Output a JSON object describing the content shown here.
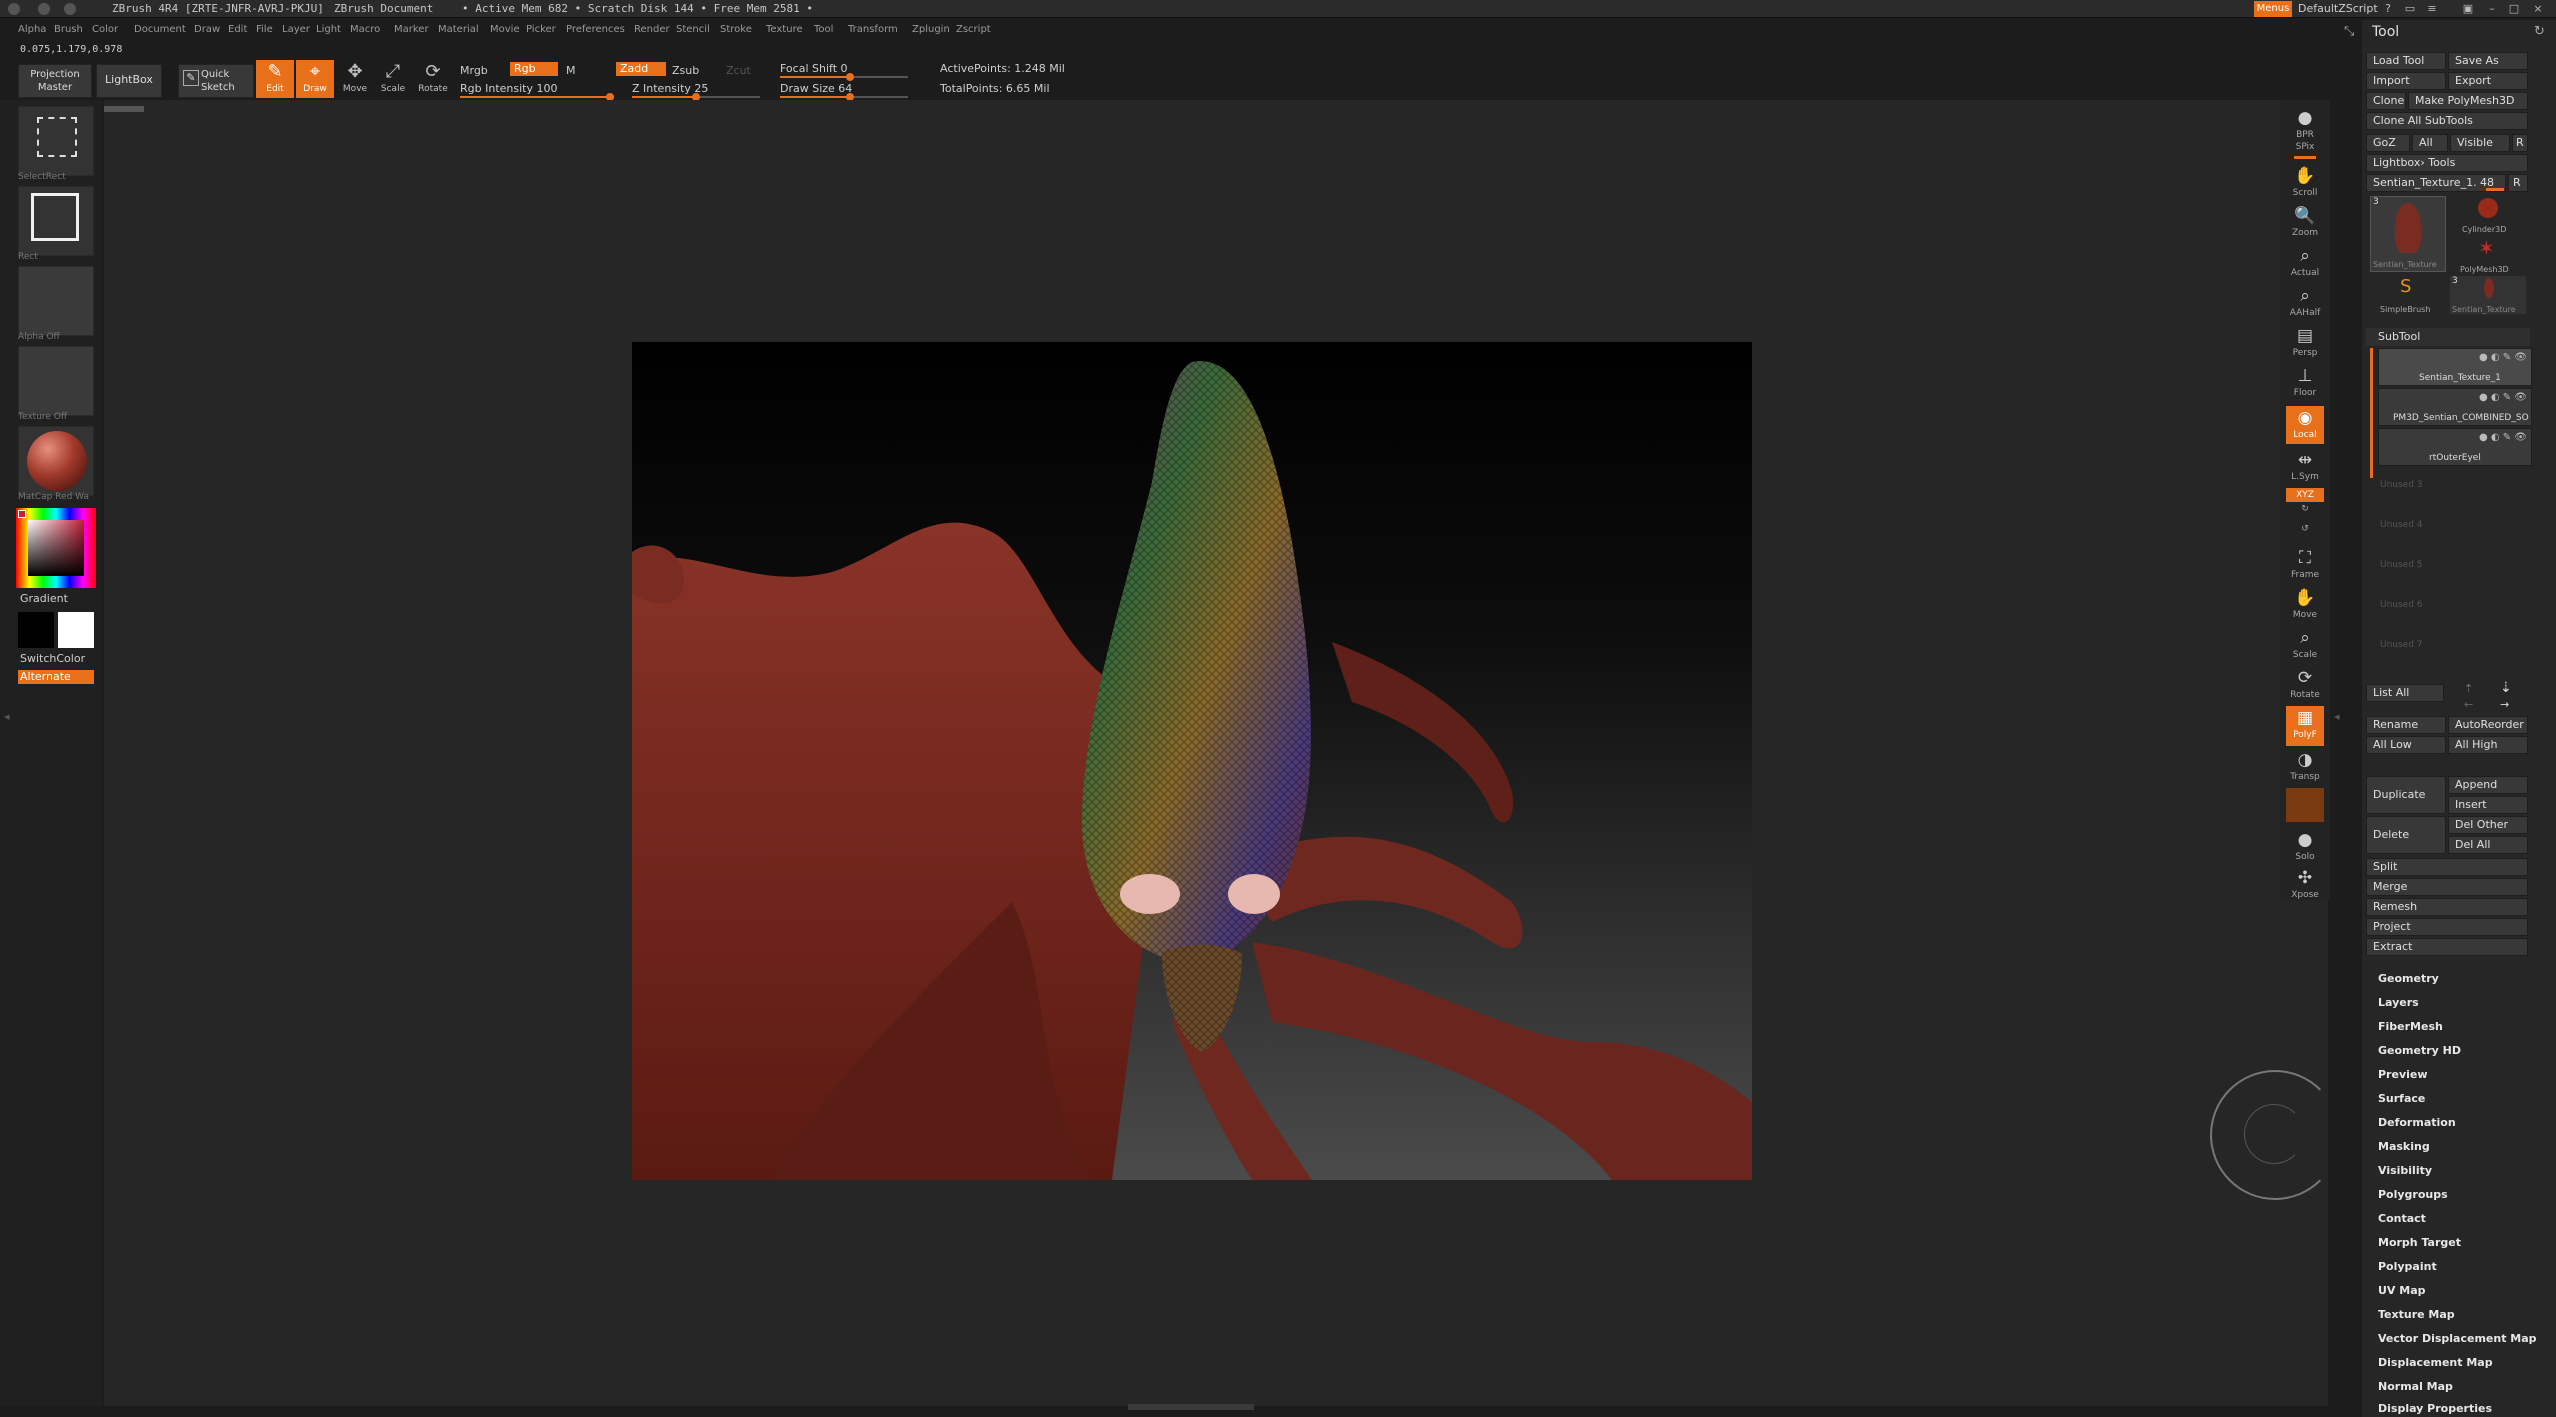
{
  "window": {
    "title_app": "ZBrush 4R4 [ZRTE-JNFR-AVRJ-PKJU]",
    "title_doc": "ZBrush Document",
    "title_mem": "•  Active Mem 682 • Scratch Disk 144 • Free Mem 2581 •",
    "menus_btn": "Menus",
    "script": "DefaultZScript"
  },
  "menubar": [
    "Alpha",
    "Brush",
    "Color",
    "Document",
    "Draw",
    "Edit",
    "File",
    "Layer",
    "Light",
    "Macro",
    "Marker",
    "Material",
    "Movie",
    "Picker",
    "Preferences",
    "Render",
    "Stencil",
    "Stroke",
    "Texture",
    "Tool",
    "Transform",
    "Zplugin",
    "Zscript"
  ],
  "coords": "0.075,1.179,0.978",
  "toolbar": {
    "projection_master": "Projection\nMaster",
    "lightbox": "LightBox",
    "quick_sketch": "Quick\nSketch",
    "edit": "Edit",
    "draw": "Draw",
    "move": "Move",
    "scale": "Scale",
    "rotate": "Rotate",
    "mrgb": "Mrgb",
    "rgb": "Rgb",
    "m": "M",
    "rgb_intensity": "Rgb Intensity 100",
    "zadd": "Zadd",
    "zsub": "Zsub",
    "zcut": "Zcut",
    "z_intensity": "Z Intensity 25",
    "focal_shift": "Focal Shift 0",
    "draw_size": "Draw Size 64",
    "active_points": "ActivePoints: 1.248  Mil",
    "total_points": "TotalPoints: 6.65  Mil",
    "rgb_intensity_value": 100,
    "z_intensity_value": 25,
    "focal_shift_value": 0,
    "draw_size_value": 64
  },
  "left_shelf": {
    "select_rect": "SelectRect",
    "rect": "Rect",
    "alpha_off": "Alpha Off",
    "texture_off": "Texture Off",
    "matcap": "MatCap Red Wa",
    "gradient": "Gradient",
    "switch_color": "SwitchColor",
    "alternate": "Alternate"
  },
  "right_shelf": [
    "BPR",
    "SPix",
    "Scroll",
    "Zoom",
    "Actual",
    "AAHalf",
    "Persp",
    "Floor",
    "Local",
    "L.Sym",
    "XYZ",
    "",
    "",
    "Frame",
    "Move",
    "Scale",
    "Rotate",
    "PolyF",
    "Transp",
    "",
    "Solo",
    "Xpose"
  ],
  "tool_panel": {
    "title": "Tool",
    "load_tool": "Load Tool",
    "save_as": "Save As",
    "import": "Import",
    "export": "Export",
    "clone": "Clone",
    "make_polymesh": "Make PolyMesh3D",
    "clone_all": "Clone  All SubTools",
    "goz": "GoZ",
    "all": "All",
    "visible": "Visible",
    "r": "R",
    "lightbox_tools": "Lightbox› Tools",
    "current_tool": "Sentian_Texture_1. 48",
    "thumbs": [
      {
        "name": "Sentian_Texture",
        "count": "3"
      },
      {
        "name": "Cylinder3D",
        "count": ""
      },
      {
        "name": "PolyMesh3D",
        "count": ""
      },
      {
        "name": "SimpleBrush",
        "count": ""
      },
      {
        "name": "Sentian_Texture",
        "count": "3"
      }
    ],
    "subtool_header": "SubTool",
    "subtools": [
      "Sentian_Texture_1",
      "PM3D_Sentian_COMBINED_SO",
      "rtOuterEyel"
    ],
    "empty_slots": [
      "Unused 3",
      "Unused 4",
      "Unused 5",
      "Unused 6",
      "Unused 7"
    ],
    "list_all": "List  All",
    "rename": "Rename",
    "auto_reorder": "AutoReorder",
    "all_low": "All  Low",
    "all_high": "All  High",
    "duplicate": "Duplicate",
    "append": "Append",
    "insert": "Insert",
    "delete": "Delete",
    "del_other": "Del Other",
    "del_all": "Del All",
    "split": "Split",
    "merge": "Merge",
    "remesh": "Remesh",
    "project": "Project",
    "extract": "Extract",
    "sections": [
      "Geometry",
      "Layers",
      "FiberMesh",
      "Geometry HD",
      "Preview",
      "Surface",
      "Deformation",
      "Masking",
      "Visibility",
      "Polygroups",
      "Contact",
      "Morph Target",
      "Polypaint",
      "UV Map",
      "Texture Map",
      "Vector Displacement Map",
      "Displacement Map",
      "Normal Map",
      "Display Properties"
    ]
  },
  "colors": {
    "accent": "#e8701a",
    "background": "#1c1c1c",
    "panel": "#262626",
    "model": "#7a2c22"
  }
}
